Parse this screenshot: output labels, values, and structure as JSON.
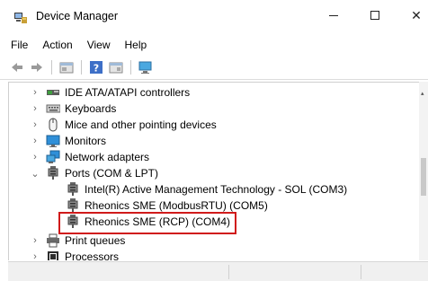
{
  "window": {
    "title": "Device Manager",
    "minimize_icon": "minimize-icon",
    "maximize_icon": "maximize-icon",
    "close_glyph": "✕"
  },
  "menu": [
    "File",
    "Action",
    "View",
    "Help"
  ],
  "toolbar": [
    "back-arrow-icon",
    "forward-arrow-icon",
    "properties-icon",
    "help-icon",
    "details-icon",
    "scan-hardware-icon"
  ],
  "tree": {
    "items": [
      {
        "label": "IDE ATA/ATAPI controllers",
        "expanded": false,
        "icon": "ide-controller-icon"
      },
      {
        "label": "Keyboards",
        "expanded": false,
        "icon": "keyboard-icon"
      },
      {
        "label": "Mice and other pointing devices",
        "expanded": false,
        "icon": "mouse-icon"
      },
      {
        "label": "Monitors",
        "expanded": false,
        "icon": "monitor-icon"
      },
      {
        "label": "Network adapters",
        "expanded": false,
        "icon": "network-adapter-icon"
      },
      {
        "label": "Ports (COM & LPT)",
        "expanded": true,
        "icon": "port-icon",
        "children": [
          {
            "label": "Intel(R) Active Management Technology - SOL (COM3)",
            "icon": "port-icon"
          },
          {
            "label": "Rheonics SME (ModbusRTU) (COM5)",
            "icon": "port-icon"
          },
          {
            "label": "Rheonics SME (RCP) (COM4)",
            "icon": "port-icon",
            "highlighted": true
          }
        ]
      },
      {
        "label": "Print queues",
        "expanded": false,
        "icon": "printer-icon"
      },
      {
        "label": "Processors",
        "expanded": false,
        "icon": "processor-icon"
      }
    ]
  },
  "colors": {
    "highlight_border": "#d01a1a"
  }
}
